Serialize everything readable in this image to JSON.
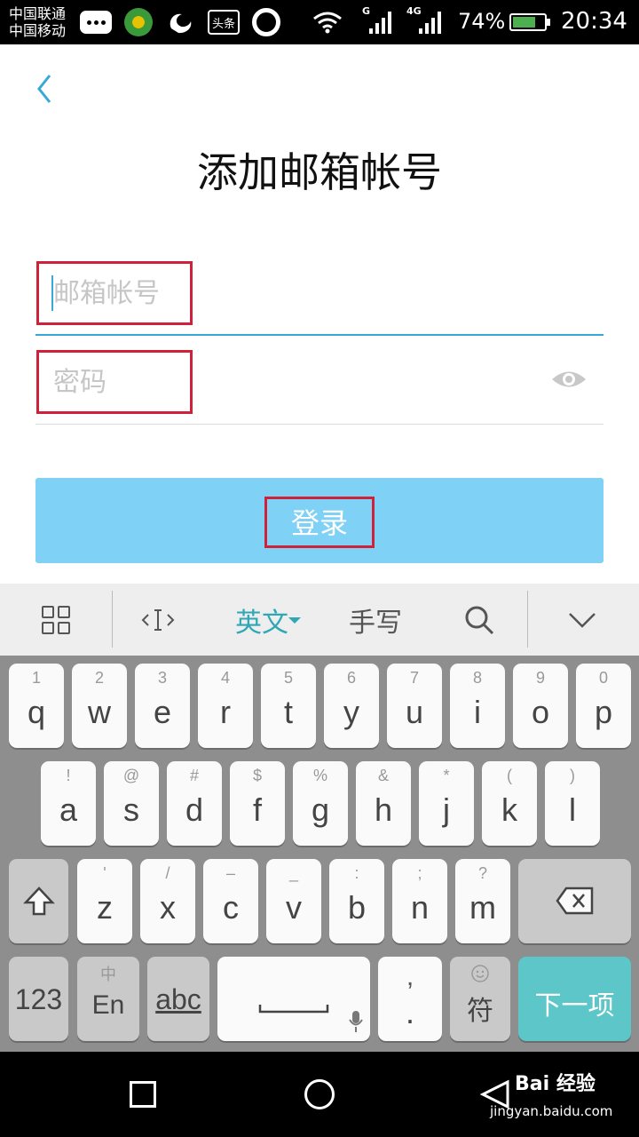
{
  "status_bar": {
    "carrier_1": "中国联通",
    "carrier_2": "中国移动",
    "notification_icons": [
      "message-bubble-icon",
      "360-security-icon",
      "uc-browser-icon",
      "toutiao-icon",
      "qq-browser-icon"
    ],
    "toutiao_label": "头条",
    "wifi_icon": "wifi-icon",
    "signal_1_label": "G",
    "signal_2_label": "4G",
    "battery_percent": "74%",
    "battery_level": 0.74,
    "time": "20:34"
  },
  "header": {
    "back_icon": "chevron-left-icon",
    "title": "添加邮箱帐号"
  },
  "form": {
    "email_placeholder": "邮箱帐号",
    "email_value": "",
    "password_placeholder": "密码",
    "password_value": "",
    "eye_icon": "eye-icon",
    "login_label": "登录"
  },
  "keyboard": {
    "toolbar": {
      "menu_icon": "grid-icon",
      "cursor_icon": "cursor-icon",
      "lang_label": "英文",
      "handwrite_label": "手写",
      "search_icon": "search-icon",
      "collapse_icon": "chevron-down-icon"
    },
    "row1": [
      {
        "sub": "1",
        "main": "q"
      },
      {
        "sub": "2",
        "main": "w"
      },
      {
        "sub": "3",
        "main": "e"
      },
      {
        "sub": "4",
        "main": "r"
      },
      {
        "sub": "5",
        "main": "t"
      },
      {
        "sub": "6",
        "main": "y"
      },
      {
        "sub": "7",
        "main": "u"
      },
      {
        "sub": "8",
        "main": "i"
      },
      {
        "sub": "9",
        "main": "o"
      },
      {
        "sub": "0",
        "main": "p"
      }
    ],
    "row2": [
      {
        "sub": "!",
        "main": "a"
      },
      {
        "sub": "@",
        "main": "s"
      },
      {
        "sub": "#",
        "main": "d"
      },
      {
        "sub": "$",
        "main": "f"
      },
      {
        "sub": "%",
        "main": "g"
      },
      {
        "sub": "&",
        "main": "h"
      },
      {
        "sub": "*",
        "main": "j"
      },
      {
        "sub": "(",
        "main": "k"
      },
      {
        "sub": ")",
        "main": "l"
      }
    ],
    "row3": [
      {
        "sub": "'",
        "main": "z"
      },
      {
        "sub": "/",
        "main": "x"
      },
      {
        "sub": "–",
        "main": "c"
      },
      {
        "sub": "_",
        "main": "v"
      },
      {
        "sub": ":",
        "main": "b"
      },
      {
        "sub": ";",
        "main": "n"
      },
      {
        "sub": "?",
        "main": "m"
      }
    ],
    "shift_icon": "shift-icon",
    "backspace_icon": "backspace-icon",
    "key_123": "123",
    "key_lang_sub": "中",
    "key_lang_main": "En",
    "key_abc": "abc",
    "space_icon": "space-icon",
    "mic_icon": "mic-icon",
    "key_comma": ",",
    "key_period": ".",
    "emoji_icon": "emoji-icon",
    "key_symbol": "符",
    "key_next": "下一项"
  },
  "nav_bar": {
    "recents_icon": "square-icon",
    "home_icon": "circle-icon",
    "back_icon": "triangle-back-icon"
  },
  "watermark": {
    "brand": "Bai 经验",
    "url": "jingyan.baidu.com"
  }
}
